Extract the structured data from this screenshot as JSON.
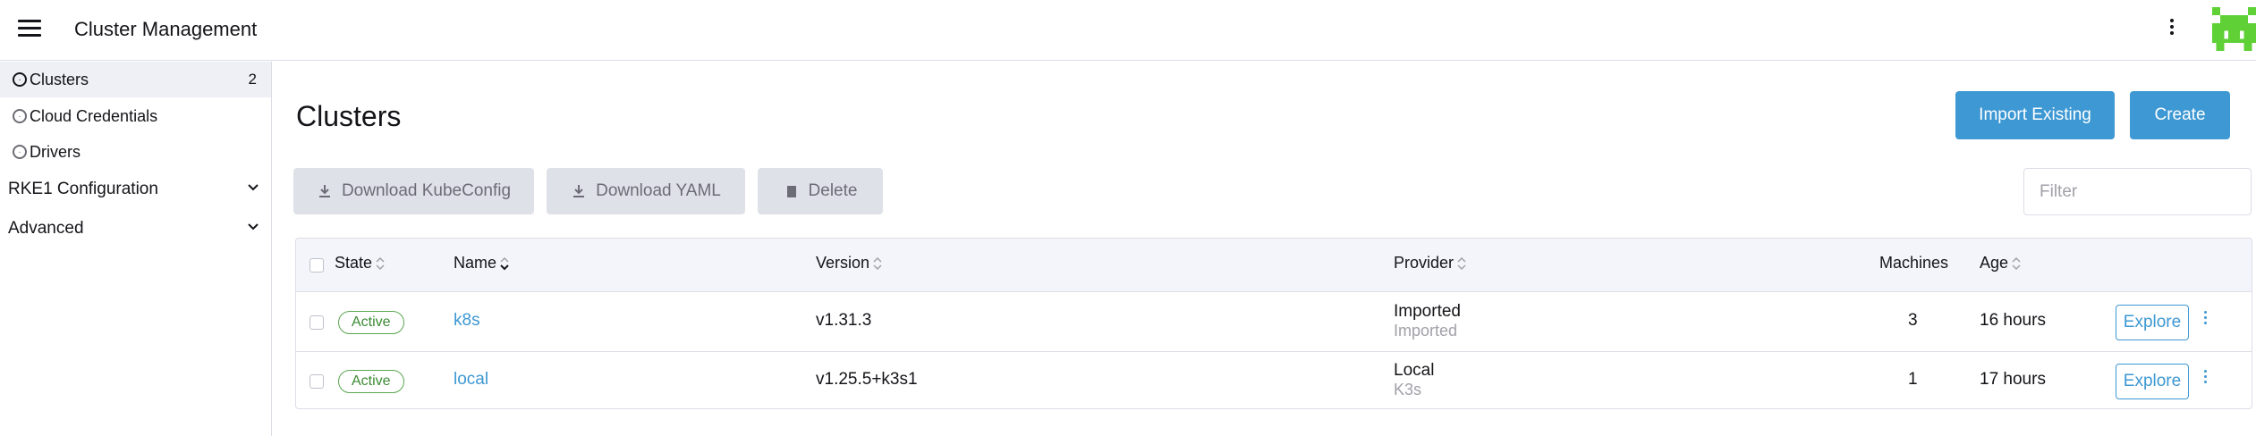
{
  "header": {
    "title": "Cluster Management"
  },
  "sidebar": {
    "items": [
      {
        "label": "Clusters",
        "count": "2",
        "icon": "globe-icon"
      },
      {
        "label": "Cloud Credentials",
        "icon": "globe-icon"
      },
      {
        "label": "Drivers",
        "icon": "globe-icon"
      }
    ],
    "groups": [
      {
        "label": "RKE1 Configuration"
      },
      {
        "label": "Advanced"
      }
    ]
  },
  "main": {
    "title": "Clusters",
    "import_label": "Import Existing",
    "create_label": "Create",
    "bulk": {
      "download_kubeconfig": "Download KubeConfig",
      "download_yaml": "Download YAML",
      "delete": "Delete"
    },
    "filter_placeholder": "Filter"
  },
  "table": {
    "headers": {
      "state": "State",
      "name": "Name",
      "version": "Version",
      "provider": "Provider",
      "machines": "Machines",
      "age": "Age"
    },
    "rows": [
      {
        "state": "Active",
        "name": "k8s",
        "version": "v1.31.3",
        "provider": "Imported",
        "provider_sub": "Imported",
        "machines": "3",
        "age": "16 hours",
        "action": "Explore"
      },
      {
        "state": "Active",
        "name": "local",
        "version": "v1.25.5+k3s1",
        "provider": "Local",
        "provider_sub": "K3s",
        "machines": "1",
        "age": "17 hours",
        "action": "Explore"
      }
    ]
  },
  "colors": {
    "primary": "#3d98d3",
    "active_badge": "#5aa550",
    "avatar": "#5fd136"
  }
}
